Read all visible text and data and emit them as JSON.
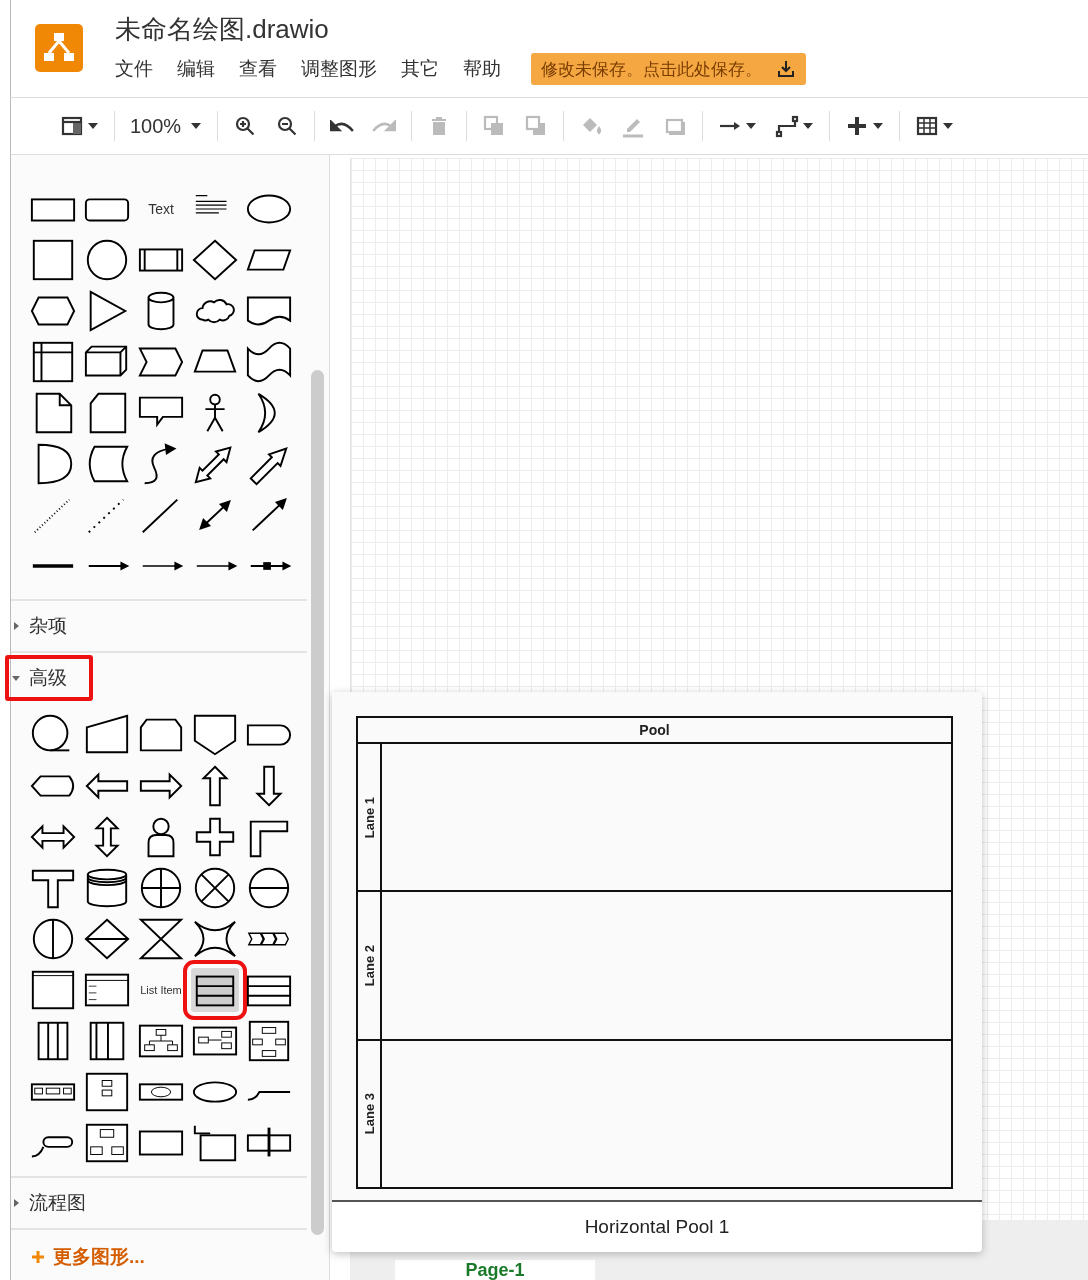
{
  "window": {
    "title": "未命名绘图.drawio"
  },
  "menu": [
    "文件",
    "编辑",
    "查看",
    "调整图形",
    "其它",
    "帮助"
  ],
  "save_notice": "修改未保存。点击此处保存。",
  "toolbar": [
    {
      "disabled": false
    },
    {
      "label": "100%",
      "disabled": false
    },
    {
      "disabled": false
    },
    {
      "disabled": false
    },
    {
      "disabled": false
    },
    {
      "disabled": true
    },
    {
      "disabled": true
    },
    {
      "disabled": true
    },
    {
      "disabled": true
    },
    {
      "disabled": true
    },
    {
      "disabled": true
    },
    {
      "disabled": true
    },
    {
      "disabled": false
    },
    {
      "disabled": false
    },
    {
      "disabled": false
    },
    {
      "disabled": false
    }
  ],
  "sidebar": {
    "general": [
      {
        "kind": "shape"
      },
      {
        "kind": "shape"
      },
      {
        "kind": "text",
        "label": "Text"
      },
      {
        "kind": "shape"
      },
      {
        "kind": "shape"
      },
      {
        "kind": "shape"
      },
      {
        "kind": "shape"
      },
      {
        "kind": "shape"
      },
      {
        "kind": "shape"
      },
      {
        "kind": "shape"
      },
      {
        "kind": "shape"
      },
      {
        "kind": "shape"
      },
      {
        "kind": "shape"
      },
      {
        "kind": "shape"
      },
      {
        "kind": "shape"
      },
      {
        "kind": "shape"
      },
      {
        "kind": "shape"
      },
      {
        "kind": "shape"
      },
      {
        "kind": "shape"
      },
      {
        "kind": "shape"
      },
      {
        "kind": "shape"
      },
      {
        "kind": "shape"
      },
      {
        "kind": "shape"
      },
      {
        "kind": "shape"
      },
      {
        "kind": "shape"
      },
      {
        "kind": "shape"
      },
      {
        "kind": "shape"
      },
      {
        "kind": "shape"
      },
      {
        "kind": "shape"
      },
      {
        "kind": "shape"
      },
      {
        "kind": "shape"
      },
      {
        "kind": "shape"
      },
      {
        "kind": "shape"
      },
      {
        "kind": "shape"
      },
      {
        "kind": "shape"
      },
      {
        "kind": "shape"
      },
      {
        "kind": "shape"
      },
      {
        "kind": "shape"
      },
      {
        "kind": "shape"
      },
      {
        "kind": "shape"
      }
    ],
    "sections": [
      {
        "title": "杂项",
        "expanded": false,
        "annotated": false
      },
      {
        "title": "高级",
        "expanded": true,
        "annotated": true,
        "items": [
          {
            "selected": false,
            "annotated": false
          },
          {
            "selected": false,
            "annotated": false
          },
          {
            "selected": false,
            "annotated": false
          },
          {
            "selected": false,
            "annotated": false
          },
          {
            "selected": false,
            "annotated": false
          },
          {
            "selected": false,
            "annotated": false
          },
          {
            "selected": false,
            "annotated": false
          },
          {
            "selected": false,
            "annotated": false
          },
          {
            "selected": false,
            "annotated": false
          },
          {
            "selected": false,
            "annotated": false
          },
          {
            "selected": false,
            "annotated": false
          },
          {
            "selected": false,
            "annotated": false
          },
          {
            "selected": false,
            "annotated": false
          },
          {
            "selected": false,
            "annotated": false
          },
          {
            "selected": false,
            "annotated": false
          },
          {
            "selected": false,
            "annotated": false
          },
          {
            "selected": false,
            "annotated": false
          },
          {
            "selected": false,
            "annotated": false
          },
          {
            "selected": false,
            "annotated": false
          },
          {
            "selected": false,
            "annotated": false
          },
          {
            "selected": false,
            "annotated": false
          },
          {
            "selected": false,
            "annotated": false
          },
          {
            "selected": false,
            "annotated": false
          },
          {
            "selected": false,
            "annotated": false
          },
          {
            "selected": false,
            "annotated": false
          },
          {
            "selected": false,
            "annotated": false
          },
          {
            "selected": false,
            "annotated": false
          },
          {
            "label": "List Item",
            "selected": false,
            "annotated": false
          },
          {
            "selected": true,
            "annotated": true
          },
          {
            "selected": false,
            "annotated": false
          },
          {
            "selected": false,
            "annotated": false
          },
          {
            "selected": false,
            "annotated": false
          },
          {
            "selected": false,
            "annotated": false
          },
          {
            "selected": false,
            "annotated": false
          },
          {
            "selected": false,
            "annotated": false
          },
          {
            "selected": false,
            "annotated": false
          },
          {
            "selected": false,
            "annotated": false
          },
          {
            "selected": false,
            "annotated": false
          },
          {
            "selected": false,
            "annotated": false
          },
          {
            "selected": false,
            "annotated": false
          },
          {
            "selected": false,
            "annotated": false
          },
          {
            "selected": false,
            "annotated": false
          },
          {
            "selected": false,
            "annotated": false
          },
          {
            "selected": false,
            "annotated": false
          },
          {
            "selected": false,
            "annotated": false
          }
        ]
      },
      {
        "title": "流程图",
        "expanded": false,
        "annotated": false
      }
    ],
    "more_shapes": "更多图形..."
  },
  "preview": {
    "pool": {
      "title": "Pool",
      "lanes": [
        "Lane 1",
        "Lane 2",
        "Lane 3"
      ]
    },
    "caption": "Horizontal Pool 1"
  },
  "pages": [
    {
      "label": "Page-1",
      "selected": true
    }
  ]
}
